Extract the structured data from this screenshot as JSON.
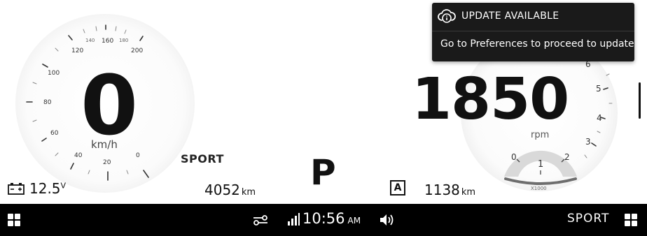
{
  "speedometer": {
    "speed": "0",
    "unit": "km/h",
    "ticks_major": [
      "20",
      "40",
      "60",
      "80",
      "100",
      "120",
      "160",
      "200"
    ],
    "ticks_minor": [
      "140",
      "180"
    ],
    "zero_label": "0"
  },
  "tachometer": {
    "rpm": "1850",
    "unit": "rpm",
    "ticks": [
      "3",
      "4",
      "5",
      "6"
    ],
    "gauge_ticks": [
      "0",
      "1",
      "2"
    ],
    "multiplier": "X1000"
  },
  "drive": {
    "mode": "SPORT",
    "gear": "P",
    "odometer_value": "4052",
    "odometer_unit": "km",
    "trip_value": "1138",
    "trip_unit": "km",
    "auto_label": "A",
    "battery_value": "12.5",
    "battery_unit": "V"
  },
  "bottom_bar": {
    "time": "10:56",
    "ampm": "AM",
    "mode": "SPORT"
  },
  "notification": {
    "title": "UPDATE AVAILABLE",
    "message": "Go to Preferences to proceed to update"
  },
  "colors": {
    "background": "#ffffff",
    "bar": "#000000",
    "toast": "#1a1a1a",
    "gauge_arc": "#6e6e6e",
    "gauge_fill": "#d9d9d9"
  }
}
